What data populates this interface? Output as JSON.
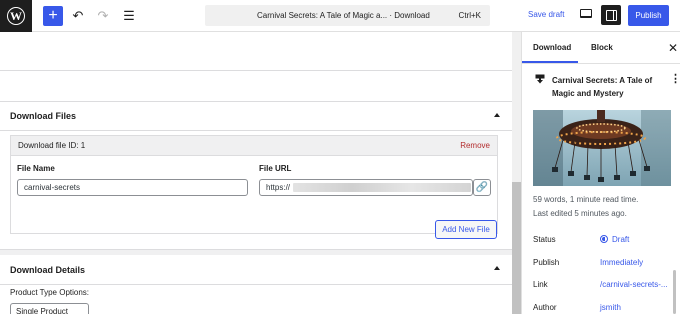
{
  "toolbar": {
    "logo_letter": "W",
    "add_label": "+",
    "undo_label": "↶",
    "redo_label": "↷",
    "outline_label": "☰",
    "command_title": "Carnival Secrets: A Tale of Magic a... · Download",
    "command_shortcut": "Ctrl+K",
    "save_draft_label": "Save draft",
    "publish_label": "Publish"
  },
  "download_files": {
    "title": "Download Files",
    "file_card": {
      "header_label": "Download file ID: 1",
      "remove_label": "Remove",
      "file_name_label": "File Name",
      "file_name_value": "carnival-secrets",
      "file_url_label": "File URL",
      "file_url_prefix": "https://",
      "file_url_suffix": ""
    },
    "add_button_label": "Add New File"
  },
  "download_details": {
    "title": "Download Details",
    "product_type_label": "Product Type Options:",
    "product_type_value": "Single Product"
  },
  "sidebar": {
    "tabs": [
      "Download",
      "Block"
    ],
    "close_label": "✕",
    "doc_title": "Carnival Secrets: A Tale of Magic and Mystery",
    "kebab_label": "⋮",
    "word_count": "59 words, 1 minute read time.",
    "last_edited": "Last edited 5 minutes ago.",
    "rows": [
      {
        "label": "Status",
        "value": "Draft"
      },
      {
        "label": "Publish",
        "value": "Immediately"
      },
      {
        "label": "Link",
        "value": "/carnival-secrets-..."
      },
      {
        "label": "Author",
        "value": "jsmith"
      }
    ]
  },
  "colors": {
    "accent": "#3858e9",
    "remove": "#b32d2e",
    "dark": "#1e1e1e"
  },
  "icons": [
    "wordpress-logo-icon",
    "plus-icon",
    "undo-icon",
    "redo-icon",
    "document-outline-icon",
    "desktop-view-icon",
    "settings-sidebar-icon",
    "close-icon",
    "download-icon",
    "kebab-menu-icon",
    "link-icon",
    "status-draft-icon",
    "chevron-up-icon"
  ]
}
